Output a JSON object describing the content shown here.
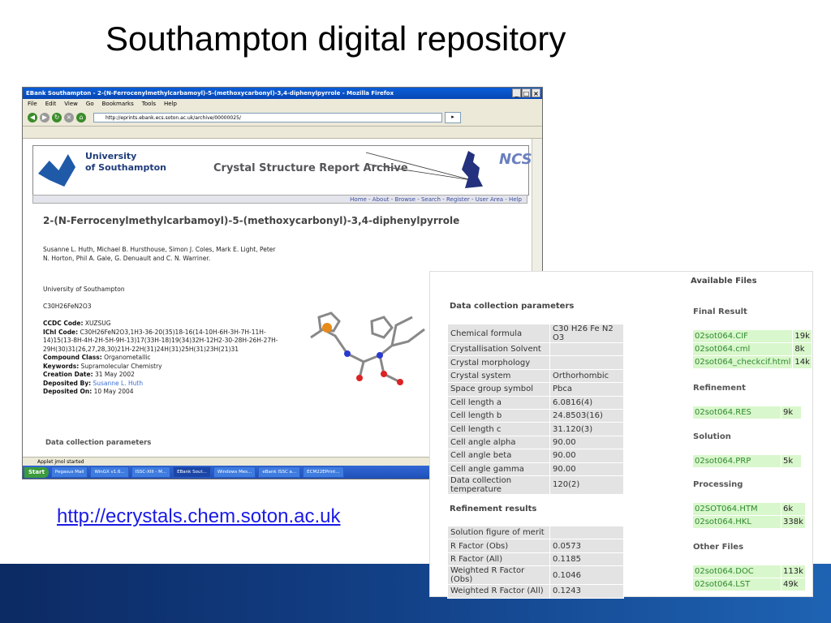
{
  "slide": {
    "title": "Southampton digital repository",
    "link": "http://ecrystals.chem.soton.ac.uk"
  },
  "browser": {
    "window_title": "EBank Southampton - 2-(N-Ferrocenylmethylcarbamoyl)-5-(methoxycarbonyl)-3,4-diphenylpyrrole - Mozilla Firefox",
    "menu": [
      "File",
      "Edit",
      "View",
      "Go",
      "Bookmarks",
      "Tools",
      "Help"
    ],
    "address": "http://eprints.ebank.ecs.soton.ac.uk/archive/00000025/",
    "status": "Applet jmol started",
    "taskbar": {
      "start": "Start",
      "items": [
        "Pegasus Mail",
        "WinGX v1.6...",
        "ISSC-XIII - M...",
        "EBank Sout...",
        "Windows Mes...",
        "eBank ISSC a...",
        "ECM22EPrint..."
      ]
    }
  },
  "site": {
    "university_line1": "University",
    "university_line2": "of Southampton",
    "archive_title": "Crystal Structure Report Archive",
    "nav": "Home - About - Browse - Search - Register - User Area - Help",
    "record_title": "2-(N-Ferrocenylmethylcarbamoyl)-5-(methoxycarbonyl)-3,4-diphenylpyrrole",
    "authors": "Susanne L. Huth, Michael B. Hursthouse, Simon J. Coles, Mark E. Light, Peter N. Horton, Phil A. Gale, G. Denuault and C. N. Warriner.",
    "affiliation": "University of Southampton",
    "formula": "C30H26FeN2O3",
    "ccdc_label": "CCDC Code:",
    "ccdc": "XUZSUG",
    "inchi_label": "IChI Code:",
    "inchi": "C30H26FeN2O3,1H3-36-20(35)18-16(14-10H-6H-3H-7H-11H-14)15(13-8H-4H-2H-5H-9H-13)17(33H-18)19(34)32H-12H2-30-28H-26H-27H-29H(30)31(26,27,28,30)21H-22H(31)24H(31)25H(31)23H(21)31",
    "class_label": "Compound Class:",
    "class": "Organometallic",
    "keywords_label": "Keywords:",
    "keywords": "Supramolecular Chemistry",
    "created_label": "Creation Date:",
    "created": "31 May 2002",
    "depby_label": "Deposited By:",
    "depby": "Susanne L. Huth",
    "depon_label": "Deposited On:",
    "depon": "10 May 2004",
    "dcp_heading": "Data collection parameters"
  },
  "data_panel": {
    "heading": "Data collection parameters",
    "params": [
      {
        "k": "Chemical formula",
        "v": "C30 H26 Fe N2 O3"
      },
      {
        "k": "Crystallisation Solvent",
        "v": ""
      },
      {
        "k": "Crystal morphology",
        "v": ""
      },
      {
        "k": "Crystal system",
        "v": "Orthorhombic"
      },
      {
        "k": "Space group symbol",
        "v": "Pbca"
      },
      {
        "k": "Cell length a",
        "v": "6.0816(4)"
      },
      {
        "k": "Cell length b",
        "v": "24.8503(16)"
      },
      {
        "k": "Cell length c",
        "v": "31.120(3)"
      },
      {
        "k": "Cell angle alpha",
        "v": "90.00"
      },
      {
        "k": "Cell angle beta",
        "v": "90.00"
      },
      {
        "k": "Cell angle gamma",
        "v": "90.00"
      },
      {
        "k": "Data collection temperature",
        "v": "120(2)"
      }
    ],
    "refinement_heading": "Refinement results",
    "refinement": [
      {
        "k": "Solution figure of merit",
        "v": ""
      },
      {
        "k": "R Factor (Obs)",
        "v": "0.0573"
      },
      {
        "k": "R Factor (All)",
        "v": "0.1185"
      },
      {
        "k": "Weighted R Factor (Obs)",
        "v": "0.1046"
      },
      {
        "k": "Weighted R Factor (All)",
        "v": "0.1243"
      }
    ],
    "files_heading": "Available Files",
    "files": {
      "final_result": {
        "label": "Final Result",
        "items": [
          {
            "name": "02sot064.CIF",
            "size": "19k"
          },
          {
            "name": "02sot064.cml",
            "size": "8k"
          },
          {
            "name": "02sot064_checkcif.html",
            "size": "14k"
          }
        ]
      },
      "refinement": {
        "label": "Refinement",
        "items": [
          {
            "name": "02sot064.RES",
            "size": "9k"
          }
        ]
      },
      "solution": {
        "label": "Solution",
        "items": [
          {
            "name": "02sot064.PRP",
            "size": "5k"
          }
        ]
      },
      "processing": {
        "label": "Processing",
        "items": [
          {
            "name": "02SOT064.HTM",
            "size": "6k"
          },
          {
            "name": "02sot064.HKL",
            "size": "338k"
          }
        ]
      },
      "other": {
        "label": "Other Files",
        "items": [
          {
            "name": "02sot064.DOC",
            "size": "113k"
          },
          {
            "name": "02sot064.LST",
            "size": "49k"
          }
        ]
      }
    }
  }
}
